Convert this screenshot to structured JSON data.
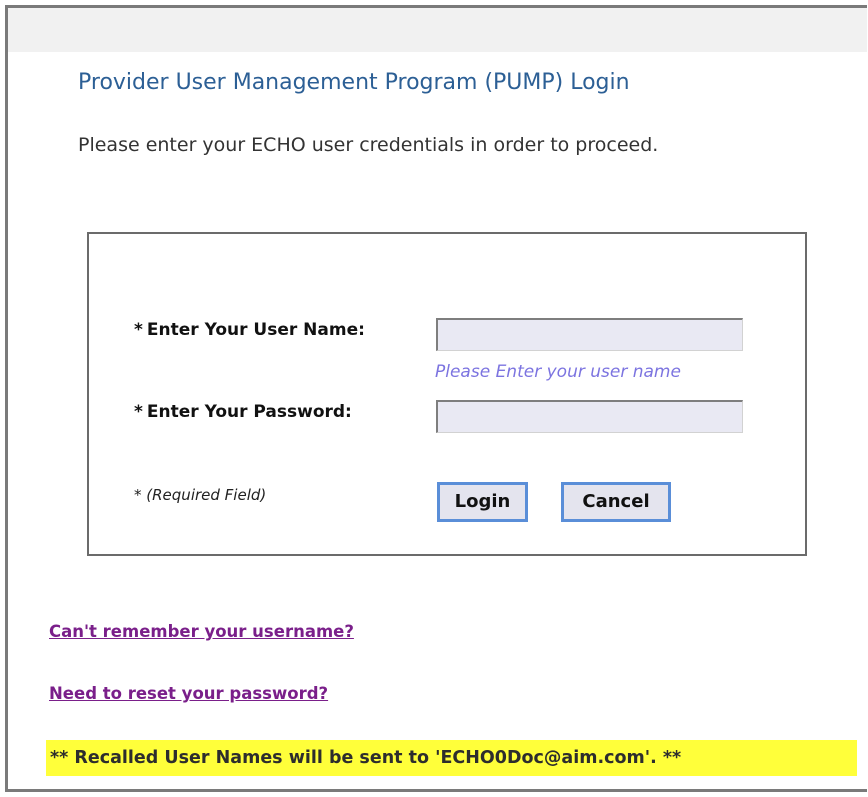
{
  "page": {
    "title": "Provider User Management Program (PUMP) Login",
    "subtitle": "Please enter your ECHO user credentials in order to proceed."
  },
  "form": {
    "required_marker": "*",
    "username": {
      "label": "Enter Your User Name:",
      "value": "",
      "hint": "Please Enter your user name"
    },
    "password": {
      "label": "Enter Your Password:",
      "value": ""
    },
    "required_note": "(Required Field)",
    "login_label": "Login",
    "cancel_label": "Cancel"
  },
  "links": {
    "forgot_username": "Can't remember your username?",
    "reset_password": "Need to reset your password?"
  },
  "notice": {
    "text": "** Recalled User Names will be sent to 'ECHO0Doc@aim.com'. **",
    "background": "#ffff3a"
  },
  "colors": {
    "title": "#2c5f95",
    "hint": "#7c74e0",
    "link": "#7a1f8a",
    "button_border": "#5a8ed8"
  }
}
